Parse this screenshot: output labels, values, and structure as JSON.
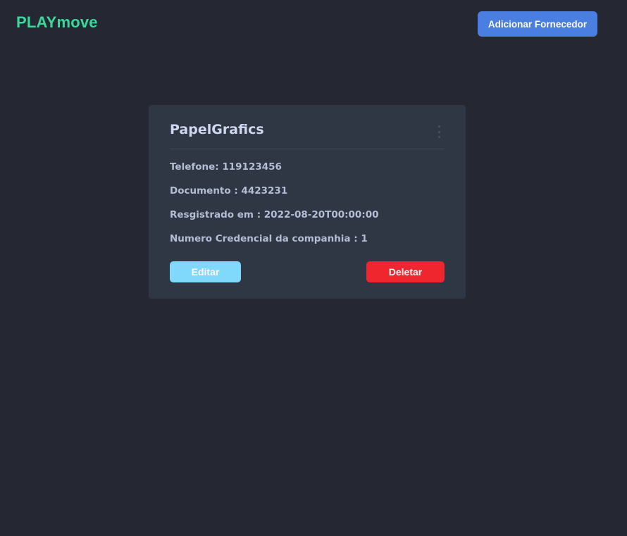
{
  "header": {
    "logo": "PLAYmove",
    "add_button_label": "Adicionar Fornecedor"
  },
  "supplier_card": {
    "name": "PapelGrafics",
    "menu_icon": "more-vertical-icon",
    "fields": [
      {
        "text": "Telefone: 119123456"
      },
      {
        "text": "Documento : 4423231"
      },
      {
        "text": "Resgistrado em : 2022-08-20T00:00:00"
      },
      {
        "text": "Numero Credencial da companhia : 1"
      }
    ],
    "edit_label": "Editar",
    "delete_label": "Deletar"
  },
  "colors": {
    "background": "#252833",
    "card": "#2f3644",
    "logo": "#38d99a",
    "primary": "#4a7ee0",
    "edit": "#80d8fb",
    "delete": "#f0262e"
  }
}
